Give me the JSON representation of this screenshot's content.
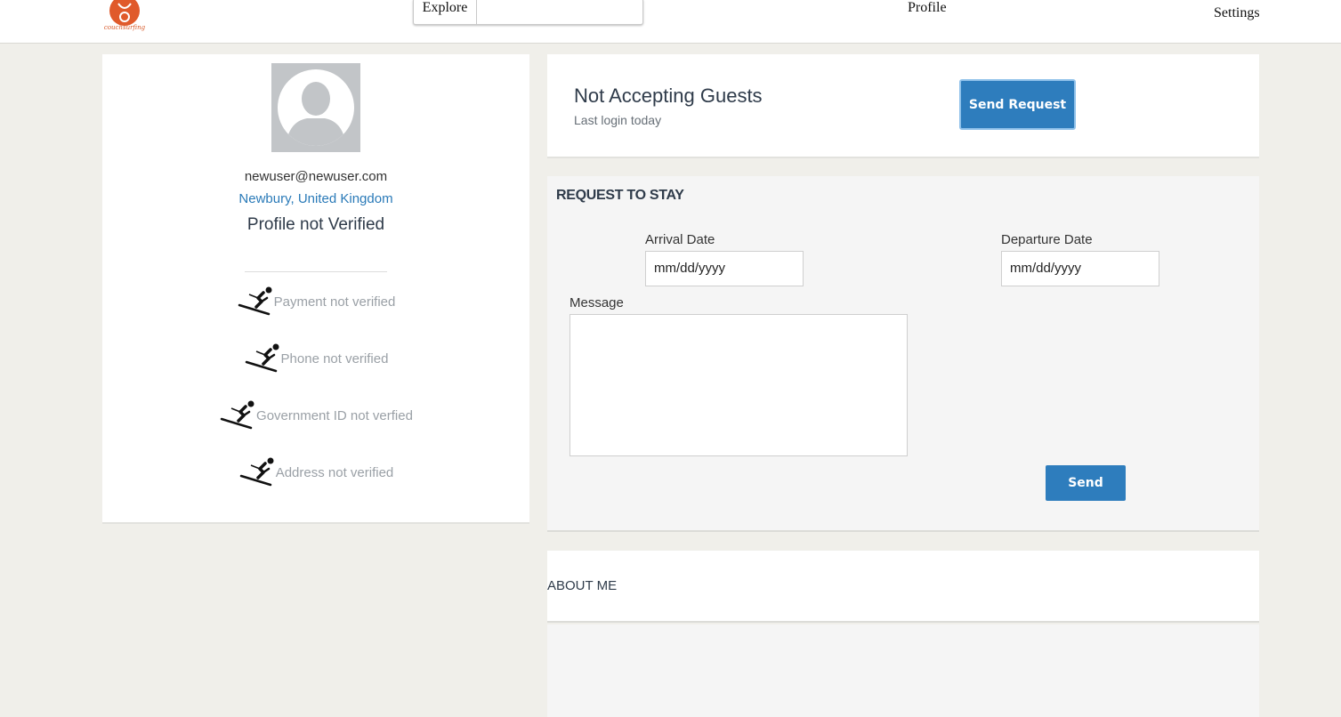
{
  "header": {
    "logo_text": "couchsurfing",
    "explore_label": "Explore",
    "explore_value": "",
    "nav_profile": "Profile",
    "nav_settings": "Settings"
  },
  "profile": {
    "email": "newuser@newuser.com",
    "location": "Newbury, United Kingdom",
    "verified_status": "Profile not Verified",
    "verifications": [
      {
        "label": "Payment not verified",
        "icon": "skier-icon"
      },
      {
        "label": "Phone not verified",
        "icon": "skier-icon"
      },
      {
        "label": "Government ID not verfied",
        "icon": "skier-icon"
      },
      {
        "label": "Address not verified",
        "icon": "skier-icon"
      }
    ]
  },
  "status": {
    "title": "Not Accepting Guests",
    "last_login": "Last login today",
    "send_request_label": "Send Request"
  },
  "request": {
    "title": "REQUEST TO STAY",
    "arrival_label": "Arrival Date",
    "arrival_placeholder": "mm/dd/yyyy",
    "departure_label": "Departure Date",
    "departure_placeholder": "mm/dd/yyyy",
    "message_label": "Message",
    "message_value": "",
    "send_label": "Send"
  },
  "about": {
    "title": "ABOUT ME"
  },
  "colors": {
    "accent": "#2e7dbd",
    "brand": "#d85a2a",
    "background": "#f0efea"
  }
}
